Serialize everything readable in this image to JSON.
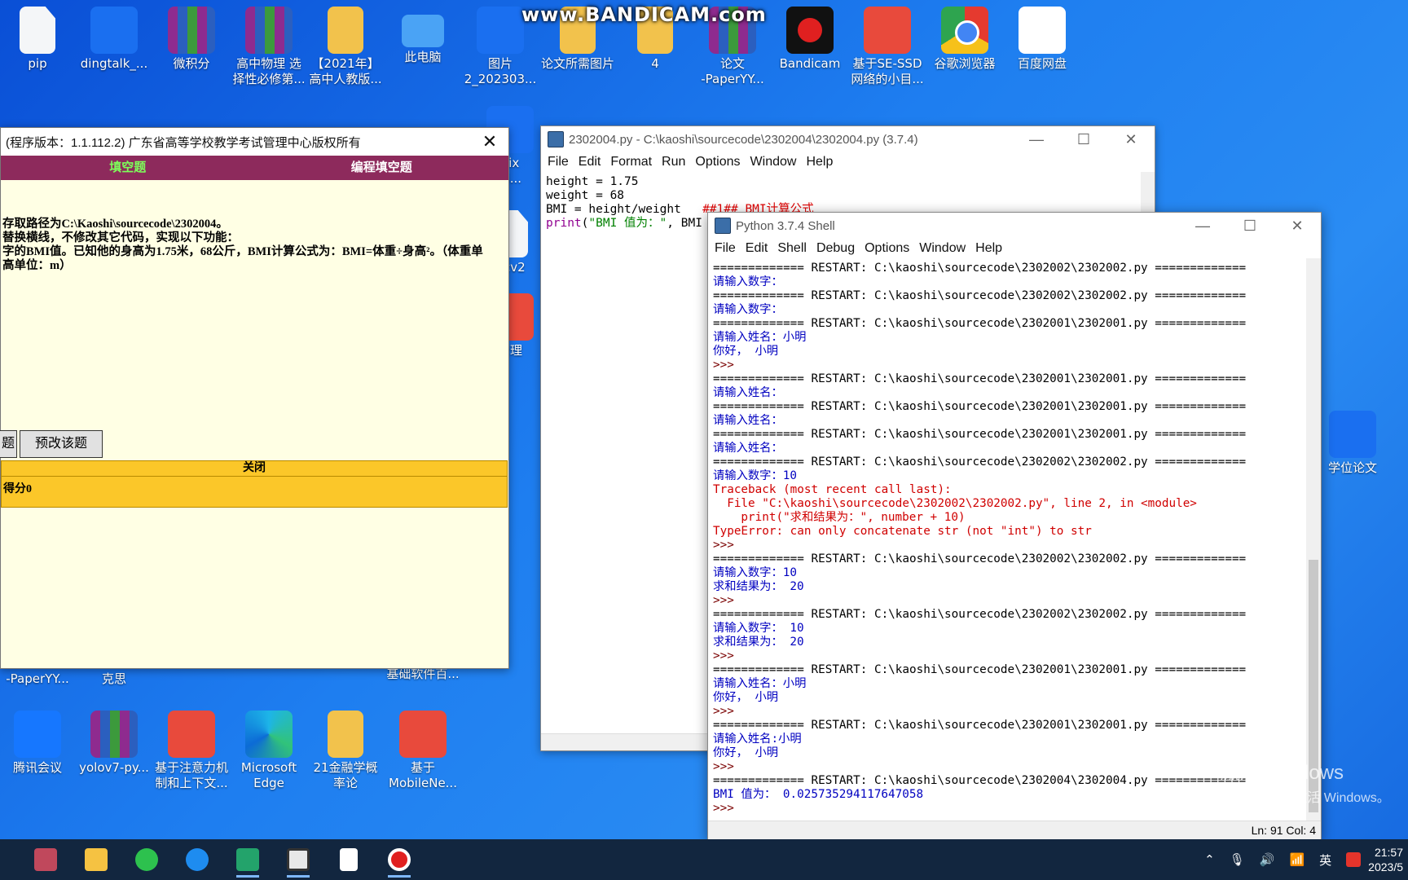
{
  "watermark": "www.BANDICAM.com",
  "desktop_icons_top": [
    {
      "label": "pip",
      "icon": "file-icon"
    },
    {
      "label": "dingtalk_...",
      "icon": "dingtalk-icon"
    },
    {
      "label": "微积分",
      "icon": "winrar-icon"
    },
    {
      "label": "高中物理 选\n择性必修第...",
      "icon": "winrar-icon"
    },
    {
      "label": "【2021年】\n高中人教版...",
      "icon": "folder-icon"
    },
    {
      "label": "此电脑",
      "icon": "computer-icon"
    },
    {
      "label": "图片\n2_202303...",
      "icon": "word-icon"
    },
    {
      "label": "论文所需图片",
      "icon": "folder-icon"
    },
    {
      "label": "4",
      "icon": "folder-icon"
    },
    {
      "label": "论文\n-PaperYY...",
      "icon": "winrar-icon"
    },
    {
      "label": "Bandicam",
      "icon": "bandicam-icon"
    },
    {
      "label": "基于SE-SSD\n网络的小目...",
      "icon": "pdf-icon"
    },
    {
      "label": "谷歌浏览器",
      "icon": "chrome-icon"
    },
    {
      "label": "百度网盘",
      "icon": "baidu-netdisk-icon"
    }
  ],
  "desktop_icons_partial": [
    {
      "label": "pix\npi...",
      "icon": "mu-editor-icon"
    },
    {
      "label": "t cv2",
      "icon": "file-icon"
    },
    {
      "label": "管理",
      "icon": "app-icon"
    }
  ],
  "desktop_icons_mid": [
    {
      "label": "-PaperYY...",
      "icon": "winrar-icon"
    },
    {
      "label": "克思",
      "icon": "file-icon"
    },
    {
      "label": "基础软件百...",
      "icon": "file-icon"
    }
  ],
  "desktop_icons_bottom": [
    {
      "label": "腾讯会议",
      "icon": "tencent-meeting-icon"
    },
    {
      "label": "yolov7-py...",
      "icon": "winrar-icon"
    },
    {
      "label": "基于注意力机\n制和上下文...",
      "icon": "pdf-icon"
    },
    {
      "label": "Microsoft\nEdge",
      "icon": "edge-icon"
    },
    {
      "label": "21金融学概\n率论",
      "icon": "folder-icon"
    },
    {
      "label": "基于\nMobileNe...",
      "icon": "pdf-icon"
    }
  ],
  "desktop_icon_right": {
    "label": "学位论文",
    "icon": "word-icon"
  },
  "exam": {
    "title": "(程序版本：1.1.112.2) 广东省高等学校教学考试管理中心版权所有",
    "tabs": [
      "填空题",
      "编程填空题"
    ],
    "instructions": [
      "存取路径为C:\\Kaoshi\\sourcecode\\2302004。",
      "替换横线，不修改其它代码，实现以下功能：",
      "字的BMI值。已知他的身高为1.75米，68公斤，BMI计算公式为：BMI=体重÷身高²。（体重单",
      "高单位：m）"
    ],
    "btn_left": "题",
    "btn_edit": "预改该题",
    "close_label": "关闭",
    "score": "得分0"
  },
  "editor": {
    "title": "2302004.py - C:\\kaoshi\\sourcecode\\2302004\\2302004.py (3.7.4)",
    "menu": [
      "File",
      "Edit",
      "Format",
      "Run",
      "Options",
      "Window",
      "Help"
    ],
    "code_lines": [
      {
        "parts": [
          {
            "t": "height = 1.75",
            "c": ""
          }
        ]
      },
      {
        "parts": [
          {
            "t": "weight = 68",
            "c": ""
          }
        ]
      },
      {
        "parts": [
          {
            "t": "BMI = height/weight   ",
            "c": ""
          },
          {
            "t": "##1## BMI计算公式",
            "c": "com"
          }
        ]
      },
      {
        "parts": [
          {
            "t": "print",
            "c": "kw"
          },
          {
            "t": "(",
            "c": ""
          },
          {
            "t": "\"BMI 值为：\"",
            "c": "str"
          },
          {
            "t": ", BMI",
            "c": ""
          }
        ]
      }
    ]
  },
  "shell": {
    "title": "Python 3.7.4 Shell",
    "menu": [
      "File",
      "Edit",
      "Shell",
      "Debug",
      "Options",
      "Window",
      "Help"
    ],
    "lines": [
      {
        "t": "============= RESTART: C:\\kaoshi\\sourcecode\\2302002\\2302002.py =============",
        "k": "restart"
      },
      {
        "t": "请输入数字：",
        "k": "out"
      },
      {
        "t": "============= RESTART: C:\\kaoshi\\sourcecode\\2302002\\2302002.py =============",
        "k": "restart"
      },
      {
        "t": "请输入数字：",
        "k": "out"
      },
      {
        "t": "============= RESTART: C:\\kaoshi\\sourcecode\\2302001\\2302001.py =============",
        "k": "restart"
      },
      {
        "t": "请输入姓名：小明",
        "k": "out"
      },
      {
        "t": "你好， 小明",
        "k": "out"
      },
      {
        "t": ">>>",
        "k": "prompt"
      },
      {
        "t": "============= RESTART: C:\\kaoshi\\sourcecode\\2302001\\2302001.py =============",
        "k": "restart"
      },
      {
        "t": "请输入姓名：",
        "k": "out"
      },
      {
        "t": "============= RESTART: C:\\kaoshi\\sourcecode\\2302001\\2302001.py =============",
        "k": "restart"
      },
      {
        "t": "请输入姓名：",
        "k": "out"
      },
      {
        "t": "============= RESTART: C:\\kaoshi\\sourcecode\\2302001\\2302001.py =============",
        "k": "restart"
      },
      {
        "t": "请输入姓名：",
        "k": "out"
      },
      {
        "t": "============= RESTART: C:\\kaoshi\\sourcecode\\2302002\\2302002.py =============",
        "k": "restart"
      },
      {
        "t": "请输入数字：10",
        "k": "out"
      },
      {
        "t": "Traceback (most recent call last):",
        "k": "err"
      },
      {
        "t": "  File \"C:\\kaoshi\\sourcecode\\2302002\\2302002.py\", line 2, in <module>",
        "k": "err"
      },
      {
        "t": "    print(\"求和结果为：\", number + 10)",
        "k": "err"
      },
      {
        "t": "TypeError: can only concatenate str (not \"int\") to str",
        "k": "err"
      },
      {
        "t": ">>>",
        "k": "prompt"
      },
      {
        "t": "============= RESTART: C:\\kaoshi\\sourcecode\\2302002\\2302002.py =============",
        "k": "restart"
      },
      {
        "t": "请输入数字：10",
        "k": "out"
      },
      {
        "t": "求和结果为： 20",
        "k": "out"
      },
      {
        "t": ">>>",
        "k": "prompt"
      },
      {
        "t": "============= RESTART: C:\\kaoshi\\sourcecode\\2302002\\2302002.py =============",
        "k": "restart"
      },
      {
        "t": "请输入数字： 10",
        "k": "out"
      },
      {
        "t": "求和结果为： 20",
        "k": "out"
      },
      {
        "t": ">>>",
        "k": "prompt"
      },
      {
        "t": "============= RESTART: C:\\kaoshi\\sourcecode\\2302001\\2302001.py =============",
        "k": "restart"
      },
      {
        "t": "请输入姓名：小明",
        "k": "out"
      },
      {
        "t": "你好， 小明",
        "k": "out"
      },
      {
        "t": ">>>",
        "k": "prompt"
      },
      {
        "t": "============= RESTART: C:\\kaoshi\\sourcecode\\2302001\\2302001.py =============",
        "k": "restart"
      },
      {
        "t": "请输入姓名:小明",
        "k": "out"
      },
      {
        "t": "你好， 小明",
        "k": "out"
      },
      {
        "t": ">>>",
        "k": "prompt"
      },
      {
        "t": "============= RESTART: C:\\kaoshi\\sourcecode\\2302004\\2302004.py =============",
        "k": "restart"
      },
      {
        "t": "BMI 值为： 0.025735294117647058",
        "k": "out"
      },
      {
        "t": ">>>",
        "k": "prompt"
      }
    ],
    "status": "Ln: 91   Col: 4"
  },
  "activation": {
    "line1": "激活 Windows",
    "line2": "转到\"设置\"以激活 Windows。"
  },
  "taskbar": {
    "items": [
      "game-app",
      "file-explorer",
      "wechat",
      "qq-browser",
      "code-editor",
      "idle-python",
      "notepad",
      "bandicam"
    ],
    "tray": {
      "ime": "英",
      "time": "21:57",
      "date": "2023/5"
    }
  },
  "colors": {
    "exam_tab_bar": "#8d2a5c",
    "exam_bg": "#ffffe4",
    "result_bar": "#fbc729",
    "shell_output": "#0000c0",
    "shell_error": "#d00000"
  }
}
